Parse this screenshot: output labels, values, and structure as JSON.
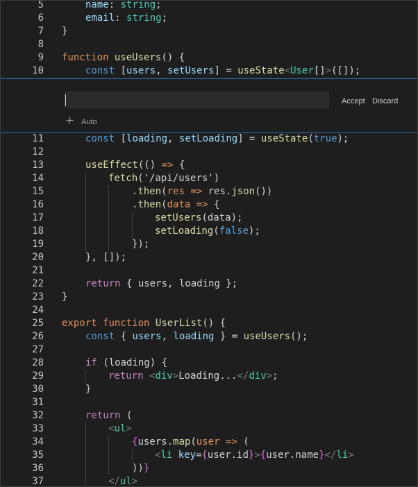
{
  "line_numbers": {
    "l5": "5",
    "l6": "6",
    "l7": "7",
    "l8": "8",
    "l9": "9",
    "l10": "10",
    "l11": "11",
    "l12": "12",
    "l13": "13",
    "l14": "14",
    "l15": "15",
    "l16": "16",
    "l17": "17",
    "l18": "18",
    "l19": "19",
    "l20": "20",
    "l21": "21",
    "l22": "22",
    "l23": "23",
    "l24": "24",
    "l25": "25",
    "l26": "26",
    "l27": "27",
    "l28": "28",
    "l29": "29",
    "l30": "30",
    "l31": "31",
    "l32": "32",
    "l33": "33",
    "l34": "34",
    "l35": "35",
    "l36": "36",
    "l37": "37"
  },
  "inline_prompt": {
    "value": "",
    "accept_label": "Accept",
    "discard_label": "Discard",
    "auto_label": "Auto"
  },
  "icons": {
    "plus": "plus-icon"
  },
  "colors": {
    "keyword": "#569cd6",
    "control": "#c586c0",
    "function": "#dcdcaa",
    "type": "#4ec9b0",
    "variable": "#9cdcfe",
    "string": "#ce9178",
    "widget_border": "#2a78c7",
    "background": "#1e1e1e"
  },
  "code": {
    "l5": [
      [
        "var",
        "name"
      ],
      [
        "pl",
        ": "
      ],
      [
        "ty",
        "string"
      ],
      [
        "pl",
        ";"
      ]
    ],
    "l6": [
      [
        "var",
        "email"
      ],
      [
        "pl",
        ": "
      ],
      [
        "ty",
        "string"
      ],
      [
        "pl",
        ";"
      ]
    ],
    "l7": [
      [
        "pl",
        "}"
      ]
    ],
    "l8": [],
    "l9": [
      [
        "kwo",
        "function"
      ],
      [
        "pl",
        " "
      ],
      [
        "fn",
        "useUsers"
      ],
      [
        "pl",
        "() {"
      ]
    ],
    "l10": [
      [
        "kw",
        "const"
      ],
      [
        "pl",
        " ["
      ],
      [
        "var",
        "users"
      ],
      [
        "pl",
        ", "
      ],
      [
        "var",
        "setUsers"
      ],
      [
        "pl",
        "] = "
      ],
      [
        "fn",
        "useState"
      ],
      [
        "ang",
        "<"
      ],
      [
        "ty",
        "User"
      ],
      [
        "pl",
        "[]"
      ],
      [
        "ang",
        ">"
      ],
      [
        "pl",
        "([]);"
      ]
    ],
    "l11": [
      [
        "kw",
        "const"
      ],
      [
        "pl",
        " ["
      ],
      [
        "var",
        "loading"
      ],
      [
        "pl",
        ", "
      ],
      [
        "var",
        "setLoading"
      ],
      [
        "pl",
        "] = "
      ],
      [
        "fn",
        "useState"
      ],
      [
        "pl",
        "("
      ],
      [
        "lit",
        "true"
      ],
      [
        "pl",
        ");"
      ]
    ],
    "l12": [],
    "l13": [
      [
        "fn",
        "useEffect"
      ],
      [
        "pl",
        "(() "
      ],
      [
        "org",
        "=>"
      ],
      [
        "pl",
        " {"
      ]
    ],
    "l14": [
      [
        "fn",
        "fetch"
      ],
      [
        "pl",
        "("
      ],
      [
        "pl",
        "'/api/users'"
      ],
      [
        "pl",
        ")"
      ]
    ],
    "l15": [
      [
        "pl",
        "."
      ],
      [
        "fn",
        "then"
      ],
      [
        "pl",
        "("
      ],
      [
        "org",
        "res"
      ],
      [
        "pl",
        " "
      ],
      [
        "org",
        "=>"
      ],
      [
        "pl",
        " res."
      ],
      [
        "fn",
        "json"
      ],
      [
        "pl",
        "())"
      ]
    ],
    "l16": [
      [
        "pl",
        "."
      ],
      [
        "fn",
        "then"
      ],
      [
        "pl",
        "("
      ],
      [
        "org",
        "data"
      ],
      [
        "pl",
        " "
      ],
      [
        "org",
        "=>"
      ],
      [
        "pl",
        " {"
      ]
    ],
    "l17": [
      [
        "fn",
        "setUsers"
      ],
      [
        "pl",
        "(data);"
      ]
    ],
    "l18": [
      [
        "fn",
        "setLoading"
      ],
      [
        "pl",
        "("
      ],
      [
        "lit",
        "false"
      ],
      [
        "pl",
        ");"
      ]
    ],
    "l19": [
      [
        "pl",
        "});"
      ]
    ],
    "l20": [
      [
        "pl",
        "}, []);"
      ]
    ],
    "l21": [],
    "l22": [
      [
        "ctl",
        "return"
      ],
      [
        "pl",
        " { users, loading };"
      ]
    ],
    "l23": [
      [
        "pl",
        "}"
      ]
    ],
    "l24": [],
    "l25": [
      [
        "kwo",
        "export"
      ],
      [
        "pl",
        " "
      ],
      [
        "kwo",
        "function"
      ],
      [
        "pl",
        " "
      ],
      [
        "fn",
        "UserList"
      ],
      [
        "pl",
        "() {"
      ]
    ],
    "l26": [
      [
        "kw",
        "const"
      ],
      [
        "pl",
        " { "
      ],
      [
        "var",
        "users"
      ],
      [
        "pl",
        ", "
      ],
      [
        "var",
        "loading"
      ],
      [
        "pl",
        " } = "
      ],
      [
        "fn",
        "useUsers"
      ],
      [
        "pl",
        "();"
      ]
    ],
    "l27": [],
    "l28": [
      [
        "ctl",
        "if"
      ],
      [
        "pl",
        " (loading) {"
      ]
    ],
    "l29": [
      [
        "ctl",
        "return"
      ],
      [
        "pl",
        " "
      ],
      [
        "ang",
        "<"
      ],
      [
        "tag",
        "div"
      ],
      [
        "ang",
        ">"
      ],
      [
        "pl",
        "Loading..."
      ],
      [
        "ang",
        "</"
      ],
      [
        "tag",
        "div"
      ],
      [
        "ang",
        ">"
      ],
      [
        "pl",
        ";"
      ]
    ],
    "l30": [
      [
        "pl",
        "}"
      ]
    ],
    "l31": [],
    "l32": [
      [
        "ctl",
        "return"
      ],
      [
        "pl",
        " ("
      ]
    ],
    "l33": [
      [
        "ang",
        "<"
      ],
      [
        "tag",
        "ul"
      ],
      [
        "ang",
        ">"
      ]
    ],
    "l34": [
      [
        "brk",
        "{"
      ],
      [
        "pl",
        "users."
      ],
      [
        "fn",
        "map"
      ],
      [
        "pl",
        "("
      ],
      [
        "org",
        "user"
      ],
      [
        "pl",
        " "
      ],
      [
        "org",
        "=>"
      ],
      [
        "pl",
        " ("
      ]
    ],
    "l35": [
      [
        "ang",
        "<"
      ],
      [
        "tag",
        "li"
      ],
      [
        "pl",
        " "
      ],
      [
        "attr",
        "key"
      ],
      [
        "pl",
        "="
      ],
      [
        "brk",
        "{"
      ],
      [
        "pl",
        "user.id"
      ],
      [
        "brk",
        "}"
      ],
      [
        "ang",
        ">"
      ],
      [
        "brk",
        "{"
      ],
      [
        "pl",
        "user.name"
      ],
      [
        "brk",
        "}"
      ],
      [
        "ang",
        "</"
      ],
      [
        "tag",
        "li"
      ],
      [
        "ang",
        ">"
      ]
    ],
    "l36": [
      [
        "pl",
        "))"
      ],
      [
        "brk",
        "}"
      ]
    ],
    "l37": [
      [
        "ang",
        "</"
      ],
      [
        "tag",
        "ul"
      ],
      [
        "ang",
        ">"
      ]
    ]
  }
}
